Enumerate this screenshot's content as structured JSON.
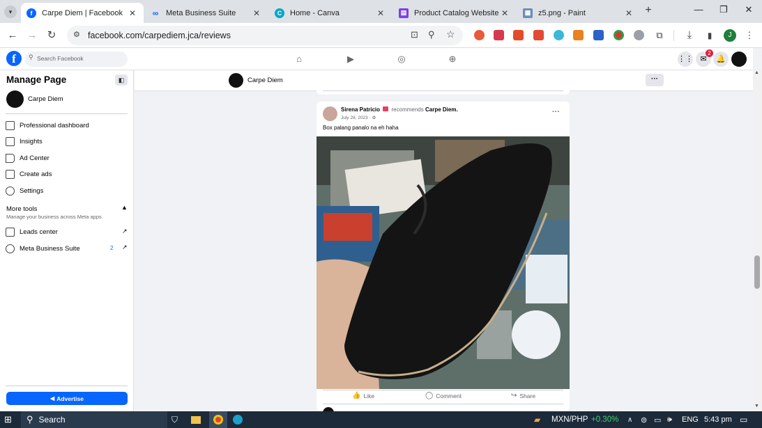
{
  "browser": {
    "tabs": [
      {
        "title": "Carpe Diem | Facebook",
        "active": true,
        "favicon_color": "#0866ff"
      },
      {
        "title": "Meta Business Suite",
        "active": false,
        "favicon_color": "#0866ff"
      },
      {
        "title": "Home - Canva",
        "active": false,
        "favicon_color": "#00c4cc"
      },
      {
        "title": "Product Catalog Website in",
        "active": false,
        "favicon_color": "#7b3fe4"
      },
      {
        "title": "z5.png - Paint",
        "active": false,
        "favicon_color": "#3a7bd5"
      }
    ],
    "new_tab_label": "+",
    "url": "facebook.com/carpediem.jca/reviews",
    "profile_initial": "J"
  },
  "facebook": {
    "search_placeholder": "Search Facebook",
    "notification_count": "2"
  },
  "sidebar": {
    "title": "Manage Page",
    "page_name": "Carpe Diem",
    "items": [
      {
        "label": "Professional dashboard",
        "icon": "dashboard-icon"
      },
      {
        "label": "Insights",
        "icon": "insights-icon"
      },
      {
        "label": "Ad Center",
        "icon": "megaphone-icon"
      },
      {
        "label": "Create ads",
        "icon": "pencil-icon"
      },
      {
        "label": "Settings",
        "icon": "gear-icon"
      }
    ],
    "more_tools": {
      "title": "More tools",
      "subtitle": "Manage your business across Meta apps",
      "items": [
        {
          "label": "Leads center",
          "icon": "leads-icon",
          "badge": ""
        },
        {
          "label": "Meta Business Suite",
          "icon": "meta-business-icon",
          "badge": "2"
        }
      ]
    },
    "advertise_label": "Advertise"
  },
  "page_header": {
    "page_name": "Carpe Diem",
    "more_label": "···"
  },
  "post": {
    "author": "Sirena Patricio",
    "verb": "recommends",
    "target": "Carpe Diem.",
    "date": "July 28, 2023 ·",
    "text": "Box palang panalo na eh haha",
    "more_label": "···",
    "actions": {
      "like": "Like",
      "comment": "Comment",
      "share": "Share"
    }
  },
  "taskbar": {
    "search_label": "Search",
    "currency": "MXN/PHP",
    "currency_change": "+0.30%",
    "currency_change_color": "#3fd46b",
    "language": "ENG",
    "time": "5:43 pm"
  }
}
